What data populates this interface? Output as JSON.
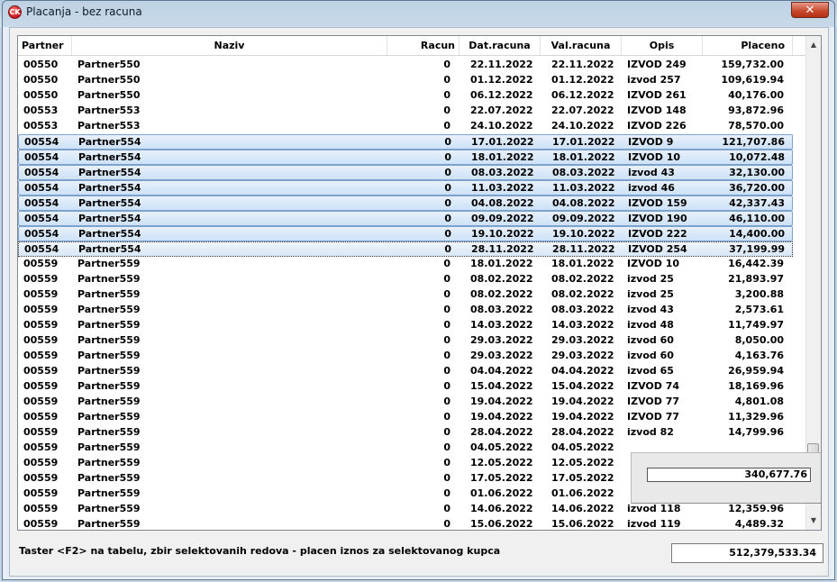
{
  "window": {
    "title": "Placanja - bez racuna",
    "close_label": "✕",
    "app_icon_text": "CK"
  },
  "columns": {
    "partner": "Partner",
    "naziv": "Naziv",
    "racun": "Racun",
    "dat": "Dat.racuna",
    "val": "Val.racuna",
    "opis": "Opis",
    "placeno": "Placeno"
  },
  "rows": [
    {
      "partner": "00550",
      "naziv": "Partner550",
      "racun": "0",
      "dat": "22.11.2022",
      "val": "22.11.2022",
      "opis": "IZVOD 249",
      "placeno": "159,732.00",
      "state": ""
    },
    {
      "partner": "00550",
      "naziv": "Partner550",
      "racun": "0",
      "dat": "01.12.2022",
      "val": "01.12.2022",
      "opis": "izvod 257",
      "placeno": "109,619.94",
      "state": ""
    },
    {
      "partner": "00550",
      "naziv": "Partner550",
      "racun": "0",
      "dat": "06.12.2022",
      "val": "06.12.2022",
      "opis": "IZVOD 261",
      "placeno": "40,176.00",
      "state": ""
    },
    {
      "partner": "00553",
      "naziv": "Partner553",
      "racun": "0",
      "dat": "22.07.2022",
      "val": "22.07.2022",
      "opis": "IZVOD 148",
      "placeno": "93,872.96",
      "state": ""
    },
    {
      "partner": "00553",
      "naziv": "Partner553",
      "racun": "0",
      "dat": "24.10.2022",
      "val": "24.10.2022",
      "opis": "IZVOD 226",
      "placeno": "78,570.00",
      "state": ""
    },
    {
      "partner": "00554",
      "naziv": "Partner554",
      "racun": "0",
      "dat": "17.01.2022",
      "val": "17.01.2022",
      "opis": "IZVOD 9",
      "placeno": "121,707.86",
      "state": "sel"
    },
    {
      "partner": "00554",
      "naziv": "Partner554",
      "racun": "0",
      "dat": "18.01.2022",
      "val": "18.01.2022",
      "opis": "IZVOD 10",
      "placeno": "10,072.48",
      "state": "sel"
    },
    {
      "partner": "00554",
      "naziv": "Partner554",
      "racun": "0",
      "dat": "08.03.2022",
      "val": "08.03.2022",
      "opis": "izvod 43",
      "placeno": "32,130.00",
      "state": "sel"
    },
    {
      "partner": "00554",
      "naziv": "Partner554",
      "racun": "0",
      "dat": "11.03.2022",
      "val": "11.03.2022",
      "opis": "izvod 46",
      "placeno": "36,720.00",
      "state": "sel"
    },
    {
      "partner": "00554",
      "naziv": "Partner554",
      "racun": "0",
      "dat": "04.08.2022",
      "val": "04.08.2022",
      "opis": "IZVOD 159",
      "placeno": "42,337.43",
      "state": "sel"
    },
    {
      "partner": "00554",
      "naziv": "Partner554",
      "racun": "0",
      "dat": "09.09.2022",
      "val": "09.09.2022",
      "opis": "IZVOD 190",
      "placeno": "46,110.00",
      "state": "sel"
    },
    {
      "partner": "00554",
      "naziv": "Partner554",
      "racun": "0",
      "dat": "19.10.2022",
      "val": "19.10.2022",
      "opis": "IZVOD 222",
      "placeno": "14,400.00",
      "state": "sel"
    },
    {
      "partner": "00554",
      "naziv": "Partner554",
      "racun": "0",
      "dat": "28.11.2022",
      "val": "28.11.2022",
      "opis": "IZVOD 254",
      "placeno": "37,199.99",
      "state": "focus"
    },
    {
      "partner": "00559",
      "naziv": "Partner559",
      "racun": "0",
      "dat": "18.01.2022",
      "val": "18.01.2022",
      "opis": "IZVOD 10",
      "placeno": "16,442.39",
      "state": ""
    },
    {
      "partner": "00559",
      "naziv": "Partner559",
      "racun": "0",
      "dat": "08.02.2022",
      "val": "08.02.2022",
      "opis": "izvod 25",
      "placeno": "21,893.97",
      "state": ""
    },
    {
      "partner": "00559",
      "naziv": "Partner559",
      "racun": "0",
      "dat": "08.02.2022",
      "val": "08.02.2022",
      "opis": "izvod 25",
      "placeno": "3,200.88",
      "state": ""
    },
    {
      "partner": "00559",
      "naziv": "Partner559",
      "racun": "0",
      "dat": "08.03.2022",
      "val": "08.03.2022",
      "opis": "izvod 43",
      "placeno": "2,573.61",
      "state": ""
    },
    {
      "partner": "00559",
      "naziv": "Partner559",
      "racun": "0",
      "dat": "14.03.2022",
      "val": "14.03.2022",
      "opis": "izvod 48",
      "placeno": "11,749.97",
      "state": ""
    },
    {
      "partner": "00559",
      "naziv": "Partner559",
      "racun": "0",
      "dat": "29.03.2022",
      "val": "29.03.2022",
      "opis": "izvod 60",
      "placeno": "8,050.00",
      "state": ""
    },
    {
      "partner": "00559",
      "naziv": "Partner559",
      "racun": "0",
      "dat": "29.03.2022",
      "val": "29.03.2022",
      "opis": "izvod 60",
      "placeno": "4,163.76",
      "state": ""
    },
    {
      "partner": "00559",
      "naziv": "Partner559",
      "racun": "0",
      "dat": "04.04.2022",
      "val": "04.04.2022",
      "opis": "izvod 65",
      "placeno": "26,959.94",
      "state": ""
    },
    {
      "partner": "00559",
      "naziv": "Partner559",
      "racun": "0",
      "dat": "15.04.2022",
      "val": "15.04.2022",
      "opis": "IZVOD 74",
      "placeno": "18,169.96",
      "state": ""
    },
    {
      "partner": "00559",
      "naziv": "Partner559",
      "racun": "0",
      "dat": "19.04.2022",
      "val": "19.04.2022",
      "opis": "IZVOD 77",
      "placeno": "4,801.08",
      "state": ""
    },
    {
      "partner": "00559",
      "naziv": "Partner559",
      "racun": "0",
      "dat": "19.04.2022",
      "val": "19.04.2022",
      "opis": "IZVOD 77",
      "placeno": "11,329.96",
      "state": ""
    },
    {
      "partner": "00559",
      "naziv": "Partner559",
      "racun": "0",
      "dat": "28.04.2022",
      "val": "28.04.2022",
      "opis": "izvod 82",
      "placeno": "14,799.96",
      "state": ""
    },
    {
      "partner": "00559",
      "naziv": "Partner559",
      "racun": "0",
      "dat": "04.05.2022",
      "val": "04.05.2022",
      "opis": "",
      "placeno": "",
      "state": ""
    },
    {
      "partner": "00559",
      "naziv": "Partner559",
      "racun": "0",
      "dat": "12.05.2022",
      "val": "12.05.2022",
      "opis": "",
      "placeno": "",
      "state": ""
    },
    {
      "partner": "00559",
      "naziv": "Partner559",
      "racun": "0",
      "dat": "17.05.2022",
      "val": "17.05.2022",
      "opis": "",
      "placeno": "",
      "state": ""
    },
    {
      "partner": "00559",
      "naziv": "Partner559",
      "racun": "0",
      "dat": "01.06.2022",
      "val": "01.06.2022",
      "opis": "",
      "placeno": "",
      "state": ""
    },
    {
      "partner": "00559",
      "naziv": "Partner559",
      "racun": "0",
      "dat": "14.06.2022",
      "val": "14.06.2022",
      "opis": "izvod 118",
      "placeno": "12,359.96",
      "state": ""
    },
    {
      "partner": "00559",
      "naziv": "Partner559",
      "racun": "0",
      "dat": "15.06.2022",
      "val": "15.06.2022",
      "opis": "izvod 119",
      "placeno": "4,489.32",
      "state": ""
    }
  ],
  "popup": {
    "selected_sum": "340,677.76"
  },
  "footer": {
    "hint": "Taster <F2> na tabelu, zbir selektovanih redova - placen iznos za selektovanog kupca",
    "total": "512,379,533.34"
  },
  "scrollbar": {
    "up_glyph": "▲",
    "down_glyph": "▼"
  }
}
